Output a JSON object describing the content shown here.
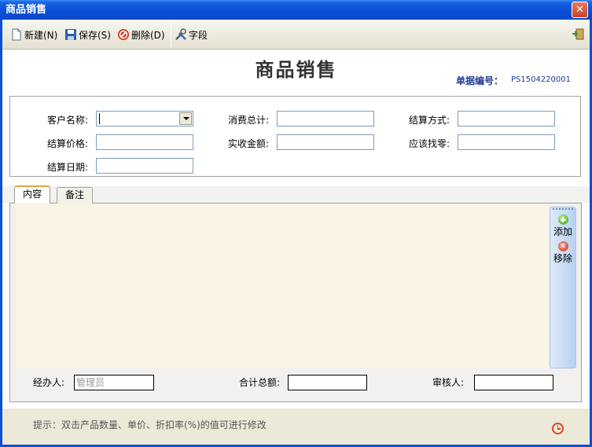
{
  "window": {
    "title": "商品销售",
    "close_label": "✕"
  },
  "toolbar": {
    "new_label": "新建(N)",
    "save_label": "保存(S)",
    "delete_label": "删除(D)",
    "fields_label": "字段"
  },
  "header": {
    "title": "商品销售",
    "doc_no_label": "单据编号：",
    "doc_no_value": "PS1504220001"
  },
  "form": {
    "customer_label": "客户名称:",
    "customer_value": "",
    "total_consume_label": "消费总计:",
    "total_consume_value": "",
    "settle_method_label": "结算方式:",
    "settle_method_value": "",
    "settle_price_label": "结算价格:",
    "settle_price_value": "",
    "received_label": "实收金额:",
    "received_value": "",
    "change_label": "应该找零:",
    "change_value": "",
    "settle_date_label": "结算日期:",
    "settle_date_value": ""
  },
  "tabs": [
    {
      "label": "内容",
      "active": true
    },
    {
      "label": "备注",
      "active": false
    }
  ],
  "side_actions": {
    "add_label": "添加",
    "remove_label": "移除"
  },
  "footer_fields": {
    "handler_label": "经办人:",
    "handler_value": "管理员",
    "total_label": "合计总额:",
    "total_value": "",
    "reviewer_label": "审核人:",
    "reviewer_value": ""
  },
  "hint": {
    "text": "提示：双击产品数量、单价、折扣率(%)的值可进行修改"
  },
  "colors": {
    "titlebar": "#0A4FD8",
    "content_bg": "#FAF4E4",
    "doc_no": "#1F3A93",
    "accent_red": "#D8462A"
  },
  "icons": [
    "new-document-icon",
    "save-disk-icon",
    "delete-icon",
    "fields-tools-icon",
    "exit-door-icon",
    "add-plus-icon",
    "remove-x-icon",
    "clock-icon",
    "dropdown-arrow-icon"
  ]
}
